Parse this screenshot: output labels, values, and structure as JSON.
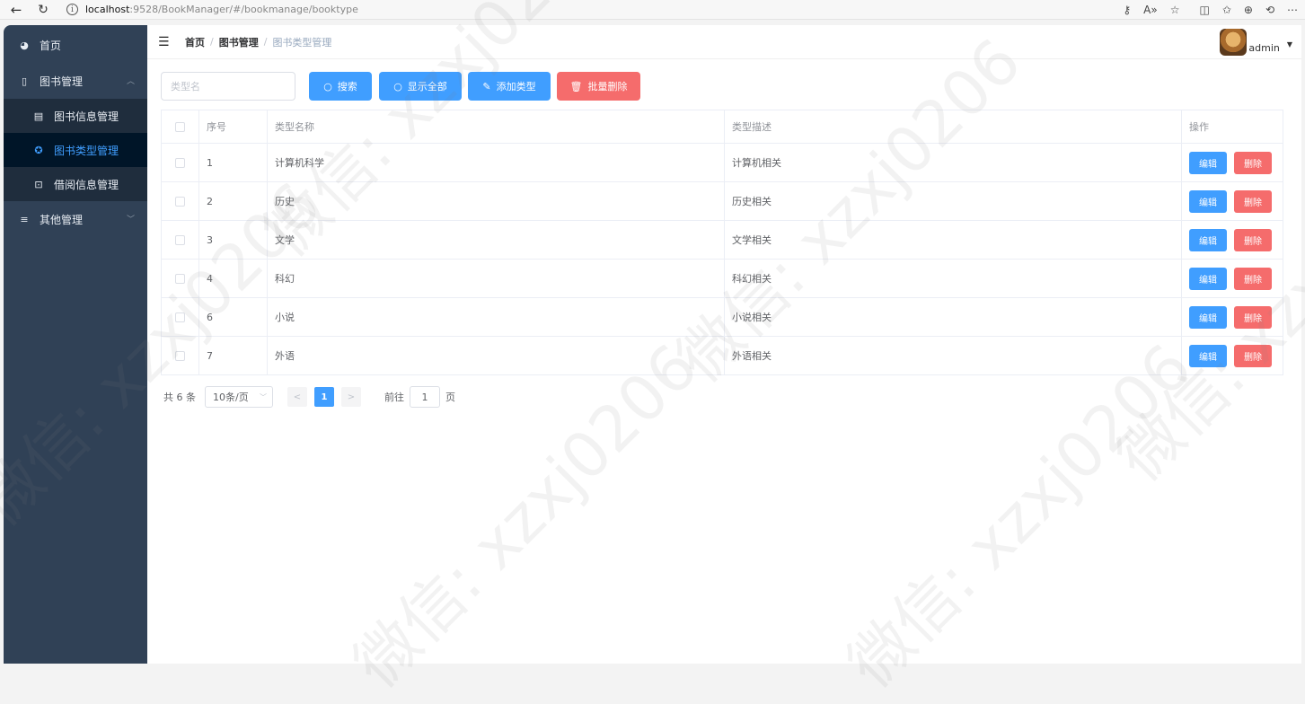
{
  "browser": {
    "url_host": "localhost",
    "url_rest": ":9528/BookManager/#/bookmanage/booktype",
    "icons": [
      "back-arrow-icon",
      "reload-icon",
      "info-icon",
      "key-icon",
      "read-aloud-icon",
      "favorite-icon",
      "split-icon",
      "favorites-icon",
      "collections-icon",
      "history-icon",
      "more-icon"
    ]
  },
  "sidebar": {
    "items": [
      {
        "label": "首页",
        "icon": "dashboard-icon"
      },
      {
        "label": "图书管理",
        "icon": "book-icon",
        "expanded": true,
        "children": [
          {
            "label": "图书信息管理",
            "icon": "document-icon",
            "active": false
          },
          {
            "label": "图书类型管理",
            "icon": "component-icon",
            "active": true
          },
          {
            "label": "借阅信息管理",
            "icon": "borrow-icon",
            "active": false
          }
        ]
      },
      {
        "label": "其他管理",
        "icon": "list-icon",
        "expanded": false
      }
    ]
  },
  "navbar": {
    "breadcrumb": [
      "首页",
      "图书管理",
      "图书类型管理"
    ],
    "username": "admin"
  },
  "toolbar": {
    "search_placeholder": "类型名",
    "search_label": "搜索",
    "show_all_label": "显示全部",
    "add_label": "添加类型",
    "batch_delete_label": "批量删除"
  },
  "table": {
    "headers": {
      "no": "序号",
      "name": "类型名称",
      "desc": "类型描述",
      "op": "操作"
    },
    "edit_label": "编辑",
    "delete_label": "删除",
    "rows": [
      {
        "no": "1",
        "name": "计算机科学",
        "desc": "计算机相关"
      },
      {
        "no": "2",
        "name": "历史",
        "desc": "历史相关"
      },
      {
        "no": "3",
        "name": "文学",
        "desc": "文学相关"
      },
      {
        "no": "4",
        "name": "科幻",
        "desc": "科幻相关"
      },
      {
        "no": "6",
        "name": "小说",
        "desc": "小说相关"
      },
      {
        "no": "7",
        "name": "外语",
        "desc": "外语相关"
      }
    ]
  },
  "pagination": {
    "total": "共 6 条",
    "page_size": "10条/页",
    "current_page": "1",
    "goto_prefix": "前往",
    "goto_value": "1",
    "goto_suffix": "页"
  },
  "watermark": "微信: xzxj0206",
  "colors": {
    "sidebar_bg": "#304156",
    "submenu_bg": "#1f2d3d",
    "active_bg": "#001528",
    "primary": "#409eff",
    "danger": "#f56c6c"
  }
}
